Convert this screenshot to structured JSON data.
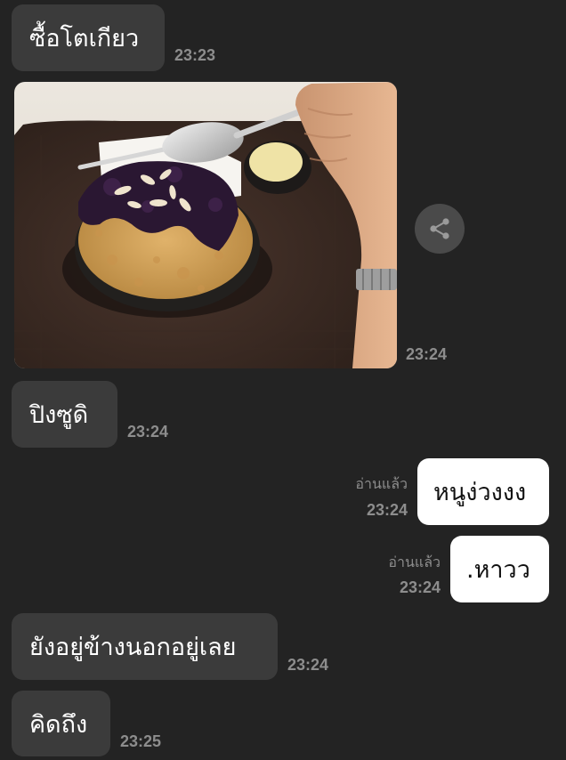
{
  "messages": [
    {
      "text": "ซื้อโตเกียว",
      "time": "23:23"
    },
    {
      "photo_alt": "food-photo",
      "time": "23:24"
    },
    {
      "text": "ปิงซูดิ",
      "time": "23:24"
    },
    {
      "text": "หนูง่วงงง",
      "time": "23:24",
      "read": "อ่านแล้ว"
    },
    {
      "text": ".หาวว",
      "time": "23:24",
      "read": "อ่านแล้ว"
    },
    {
      "text": "ยังอยู่ข้างนอกอยู่เลย",
      "time": "23:24"
    },
    {
      "text": "คิดถึง",
      "time": "23:25"
    }
  ],
  "share": {
    "icon": "share-icon"
  },
  "colors": {
    "background": "#232323",
    "incoming_bubble": "#3b3b3b",
    "outgoing_bubble": "#ffffff",
    "timestamp": "#8d8d8d"
  }
}
